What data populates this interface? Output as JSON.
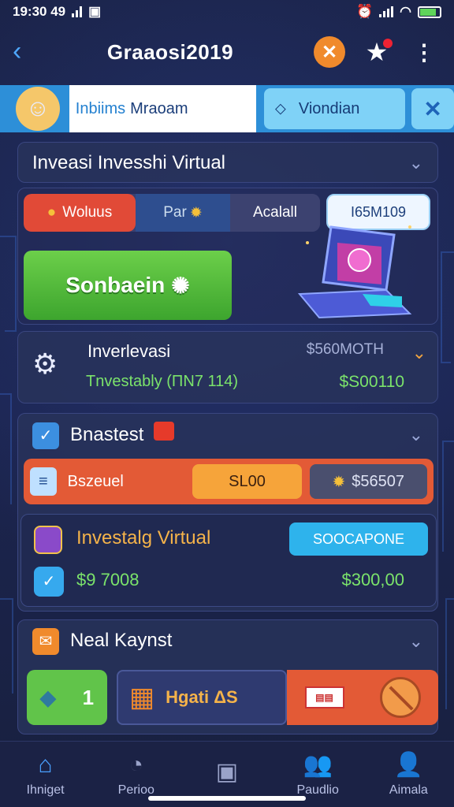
{
  "status_bar": {
    "time": "19:30 49",
    "tab_icon": "▣"
  },
  "header": {
    "title": "Graaosi2019"
  },
  "banner": {
    "tab_white_a": "Inbiims",
    "tab_white_b": "Mraoam",
    "tab_cyan": "Viondian",
    "close": "✕"
  },
  "section1": {
    "title": "Inveasi Invesshi Virtual",
    "segments": {
      "red": "Woluus",
      "blue": "Par",
      "grey": "Acalall"
    },
    "date": "I65M109",
    "green_button": "Sonbaein"
  },
  "invest_card": {
    "title": "Inverlevasi",
    "subtitle": "Tnvestably (ΠΝ7 114)",
    "label": "$560MOTH",
    "value": "$S00110"
  },
  "section2": {
    "title": "Bnastest",
    "orange_row": {
      "label": "Bszeuel",
      "amount": "SL00",
      "gear_value": "$56507"
    },
    "inner": {
      "title": "Investalg Virtual",
      "cta": "SOOCAPONE",
      "left_value": "$9 7008",
      "right_value": "$300,00"
    }
  },
  "section3": {
    "title": "Neal Kaynst",
    "green_num": "1",
    "dark_label": "Hgati ΔS"
  },
  "nav": [
    {
      "label": "Ihniget",
      "icon": "⌂"
    },
    {
      "label": "Perioo",
      "icon": "◔"
    },
    {
      "label": "",
      "icon": "▣"
    },
    {
      "label": "Paudlio",
      "icon": "👥"
    },
    {
      "label": "Aimala",
      "icon": "👤"
    }
  ],
  "colors": {
    "accent_blue": "#2d8fd8",
    "green": "#61c44a",
    "orange": "#e35a36",
    "bg": "#17203f"
  }
}
